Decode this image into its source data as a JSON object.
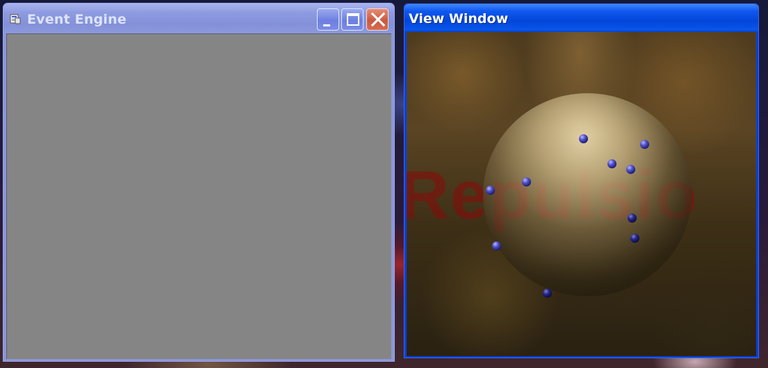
{
  "event_window": {
    "title": "Event Engine",
    "buttons": {
      "minimize": "minimize-icon",
      "maximize": "maximize-icon",
      "close": "close-icon"
    },
    "client_color": "#858585",
    "active": false
  },
  "view_window": {
    "title": "View Window",
    "active": true,
    "scene": {
      "watermark_text": "Repulsio",
      "sphere_color": "#c6b282",
      "particle_color": "#3a3ab8",
      "particle_count": 11
    }
  }
}
